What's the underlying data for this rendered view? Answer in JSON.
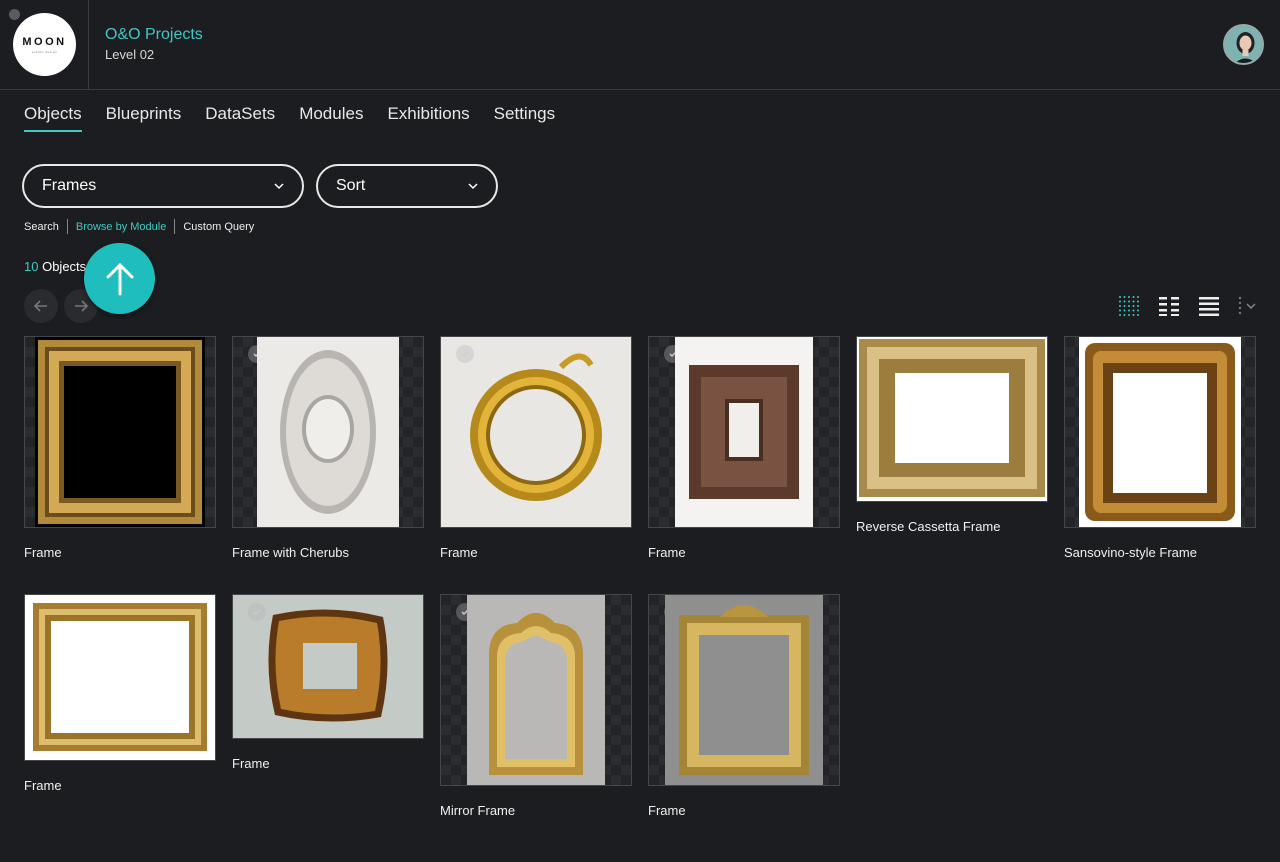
{
  "app": {
    "logo_text": "MOON",
    "logo_sub": "exhibit design",
    "project": "O&O Projects",
    "level": "Level 02"
  },
  "tabs": [
    "Objects",
    "Blueprints",
    "DataSets",
    "Modules",
    "Exhibitions",
    "Settings"
  ],
  "active_tab": "Objects",
  "filters": {
    "collection": "Frames",
    "sort": "Sort"
  },
  "modes": [
    "Search",
    "Browse by Module",
    "Custom Query"
  ],
  "active_mode": "Browse by Module",
  "count": {
    "number": "10",
    "label": "Objects"
  },
  "colors": {
    "accent": "#3ec9c4",
    "fab": "#1fbdbd",
    "background": "#1c1d20"
  },
  "view_icons": [
    "grid-dots-icon",
    "columns-icon",
    "list-icon",
    "more-options-icon"
  ],
  "objects": [
    {
      "title": "Frame",
      "style": "gold-black"
    },
    {
      "title": "Frame with Cherubs",
      "style": "silver-oval"
    },
    {
      "title": "Frame",
      "style": "gold-round"
    },
    {
      "title": "Frame",
      "style": "wood-carved"
    },
    {
      "title": "Reverse Cassetta Frame",
      "style": "gold-landscape"
    },
    {
      "title": "Sansovino-style Frame",
      "style": "ornate-gold"
    },
    {
      "title": "Frame",
      "style": "gold-white"
    },
    {
      "title": "Frame",
      "style": "tortoise"
    },
    {
      "title": "Mirror Frame",
      "style": "mirror-arch"
    },
    {
      "title": "Frame",
      "style": "ornate-grey"
    }
  ]
}
